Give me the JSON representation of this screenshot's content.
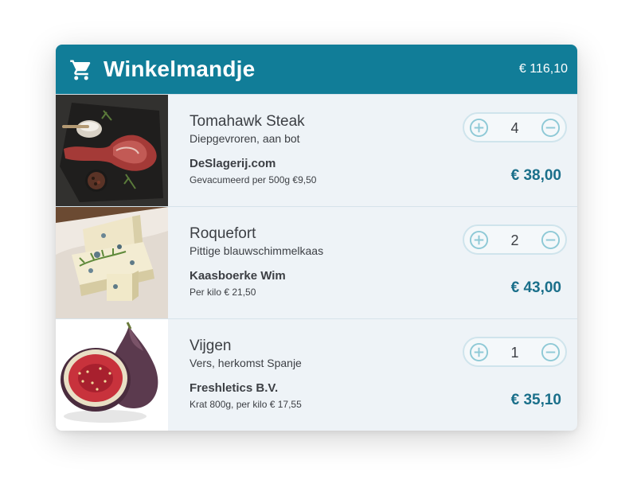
{
  "header": {
    "title": "Winkelmandje",
    "total": "€ 116,10",
    "cart_icon": "shopping-cart-icon",
    "color": "#117d98"
  },
  "items": [
    {
      "image": "tomahawk-steak-photo",
      "name": "Tomahawk Steak",
      "description": "Diepgevroren, aan bot",
      "vendor": "DeSlagerij.com",
      "info": "Gevacumeerd per 500g €9,50",
      "quantity": "4",
      "price": "€ 38,00"
    },
    {
      "image": "roquefort-cheese-photo",
      "name": "Roquefort",
      "description": "Pittige blauwschimmelkaas",
      "vendor": "Kaasboerke Wim",
      "info": "Per kilo € 21,50",
      "quantity": "2",
      "price": "€ 43,00"
    },
    {
      "image": "figs-photo",
      "name": "Vijgen",
      "description": "Vers, herkomst Spanje",
      "vendor": "Freshletics B.V.",
      "info": "Krat 800g, per kilo € 17,55",
      "quantity": "1",
      "price": "€ 35,10"
    }
  ],
  "stepper_icons": {
    "increase": "plus-circle-icon",
    "decrease": "minus-circle-icon"
  },
  "colors": {
    "accent": "#117d98",
    "price": "#1a6f8a",
    "stepper_icon": "#8ec9d6",
    "background": "#eef3f7"
  }
}
